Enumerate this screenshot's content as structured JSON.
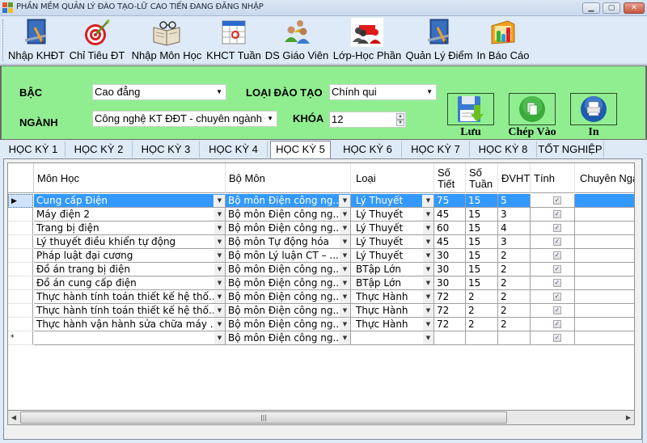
{
  "window": {
    "title": "PHẦN MỀM QUẢN LÝ ĐÀO TẠO-LỮ CAO TIẾN ĐANG ĐĂNG NHẬP",
    "controls": {
      "minimize": "▁",
      "maximize": "▢",
      "close": "✕"
    }
  },
  "toolbar": {
    "items": [
      {
        "label": "Nhập KHĐT",
        "icon": "blueprint-pencil-icon"
      },
      {
        "label": "Chỉ Tiêu ĐT",
        "icon": "target-dart-icon"
      },
      {
        "label": "Nhập Môn Học",
        "icon": "book-glasses-icon"
      },
      {
        "label": "KHCT Tuần",
        "icon": "calendar-icon"
      },
      {
        "label": "DS Giáo Viên",
        "icon": "people-group-icon"
      },
      {
        "label": "Lớp-Học Phần",
        "icon": "classroom-icon"
      },
      {
        "label": "Quản Lý Điểm",
        "icon": "blueprint-pencil-icon"
      },
      {
        "label": "In Báo Cáo",
        "icon": "bar-chart-icon"
      }
    ]
  },
  "filters": {
    "bac_label": "BẬC",
    "bac_value": "Cao đẳng",
    "loai_dao_tao_label": "LOẠI ĐÀO TẠO",
    "loai_dao_tao_value": "Chính qui",
    "nganh_label": "NGÀNH",
    "nganh_value": "Công nghệ KT ĐĐT - chuyên ngành Đ",
    "khoa_label": "KHÓA",
    "khoa_value": "12",
    "dropdown_arrow": "▼",
    "spin_up": "▲",
    "spin_down": "▼"
  },
  "actions": {
    "save_label": "Lưu",
    "copy_label": "Chép Vào",
    "print_label": "In"
  },
  "tabs": [
    {
      "label": "HỌC KỲ 1",
      "active": false
    },
    {
      "label": "HỌC KỲ 2",
      "active": false
    },
    {
      "label": "HỌC KỲ 3",
      "active": false
    },
    {
      "label": "HỌC KỲ 4",
      "active": false
    },
    {
      "label": "HỌC KỲ 5",
      "active": true
    },
    {
      "label": "HỌC KỲ 6",
      "active": false
    },
    {
      "label": "HỌC KỲ 7",
      "active": false
    },
    {
      "label": "HỌC KỲ 8",
      "active": false
    },
    {
      "label": "TỐT NGHIỆP",
      "active": false
    }
  ],
  "grid": {
    "columns": {
      "mon_hoc": "Môn Học",
      "bo_mon": "Bộ Môn",
      "loai": "Loại",
      "so_tiet_1": "Số",
      "so_tiet_2": "Tiết",
      "so_tuan_1": "Số",
      "so_tuan_2": "Tuần",
      "dvht": "ĐVHT",
      "tinh": "Tính",
      "chuyen_nganh": "Chuyên Ngành"
    },
    "current_row_marker": "▶",
    "new_row_marker": "*",
    "check_mark": "✓",
    "rows": [
      {
        "mon_hoc": "Cung cấp Điện",
        "bo_mon": "Bộ môn Điện công ng...",
        "loai": "Lý Thuyết",
        "so_tiet": "75",
        "so_tuan": "15",
        "dvht": "5",
        "tinh": true,
        "chuyen_nganh": "",
        "selected": true
      },
      {
        "mon_hoc": "Máy điện 2",
        "bo_mon": "Bộ môn Điện công ng...",
        "loai": "Lý Thuyết",
        "so_tiet": "45",
        "so_tuan": "15",
        "dvht": "3",
        "tinh": true,
        "chuyen_nganh": ""
      },
      {
        "mon_hoc": "Trang bị điện",
        "bo_mon": "Bộ môn Điện công ng...",
        "loai": "Lý Thuyết",
        "so_tiet": "60",
        "so_tuan": "15",
        "dvht": "4",
        "tinh": true,
        "chuyen_nganh": ""
      },
      {
        "mon_hoc": "Lý thuyết điều khiển tự động",
        "bo_mon": "Bộ môn Tự động hóa",
        "loai": "Lý Thuyết",
        "so_tiet": "45",
        "so_tuan": "15",
        "dvht": "3",
        "tinh": true,
        "chuyen_nganh": ""
      },
      {
        "mon_hoc": "Pháp luật đại cương",
        "bo_mon": "Bộ môn Lý luận CT – ...",
        "loai": "Lý Thuyết",
        "so_tiet": "30",
        "so_tuan": "15",
        "dvht": "2",
        "tinh": true,
        "chuyen_nganh": ""
      },
      {
        "mon_hoc": "Đồ án trang bị điện",
        "bo_mon": "Bộ môn Điện công ng...",
        "loai": "BTập Lớn",
        "so_tiet": "30",
        "so_tuan": "15",
        "dvht": "2",
        "tinh": true,
        "chuyen_nganh": ""
      },
      {
        "mon_hoc": "Đồ án cung cấp điện",
        "bo_mon": "Bộ môn Điện công ng...",
        "loai": "BTập Lớn",
        "so_tiet": "30",
        "so_tuan": "15",
        "dvht": "2",
        "tinh": true,
        "chuyen_nganh": ""
      },
      {
        "mon_hoc": "Thực hành tính toán thiết kế hệ thố...",
        "bo_mon": "Bộ môn Điện công ng...",
        "loai": "Thực Hành",
        "so_tiet": "72",
        "so_tuan": "2",
        "dvht": "2",
        "tinh": true,
        "chuyen_nganh": ""
      },
      {
        "mon_hoc": "Thực hành tính toán thiết kế hệ thố...",
        "bo_mon": "Bộ môn Điện công ng...",
        "loai": "Thực Hành",
        "so_tiet": "72",
        "so_tuan": "2",
        "dvht": "2",
        "tinh": true,
        "chuyen_nganh": ""
      },
      {
        "mon_hoc": "Thực hành vận hành sửa chữa máy ...",
        "bo_mon": "Bộ môn Điện công ng...",
        "loai": "Thực Hành",
        "so_tiet": "72",
        "so_tuan": "2",
        "dvht": "2",
        "tinh": true,
        "chuyen_nganh": ""
      },
      {
        "mon_hoc": "",
        "bo_mon": "Bộ môn Điện công ng...",
        "loai": "",
        "so_tiet": "",
        "so_tuan": "",
        "dvht": "",
        "tinh": true,
        "chuyen_nganh": "",
        "new_row": true
      }
    ]
  },
  "scrollbar": {
    "left_arrow": "◀",
    "right_arrow": "▶",
    "thumb_grip": "|||"
  }
}
